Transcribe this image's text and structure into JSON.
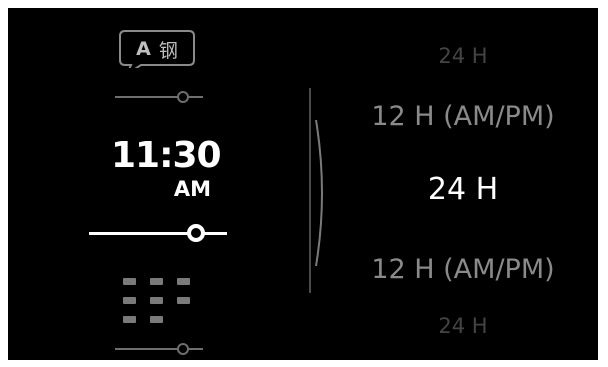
{
  "menu": {
    "language": {
      "icon": "language-icon",
      "letter": "A",
      "glyph": "钢"
    },
    "time_format": {
      "clock_time": "11:30",
      "clock_ampm": "AM"
    },
    "grid": {
      "icon": "grid-icon"
    }
  },
  "picker": {
    "options": [
      "24 H",
      "12 H (AM/PM)",
      "24 H",
      "12 H (AM/PM)",
      "24 H"
    ],
    "selected_index": 2
  },
  "colors": {
    "background": "#000000",
    "selected_text": "#ffffff",
    "dim_text": "#8a8a8a",
    "faint_text": "#444444",
    "inactive_slider": "#6e6e6e"
  }
}
